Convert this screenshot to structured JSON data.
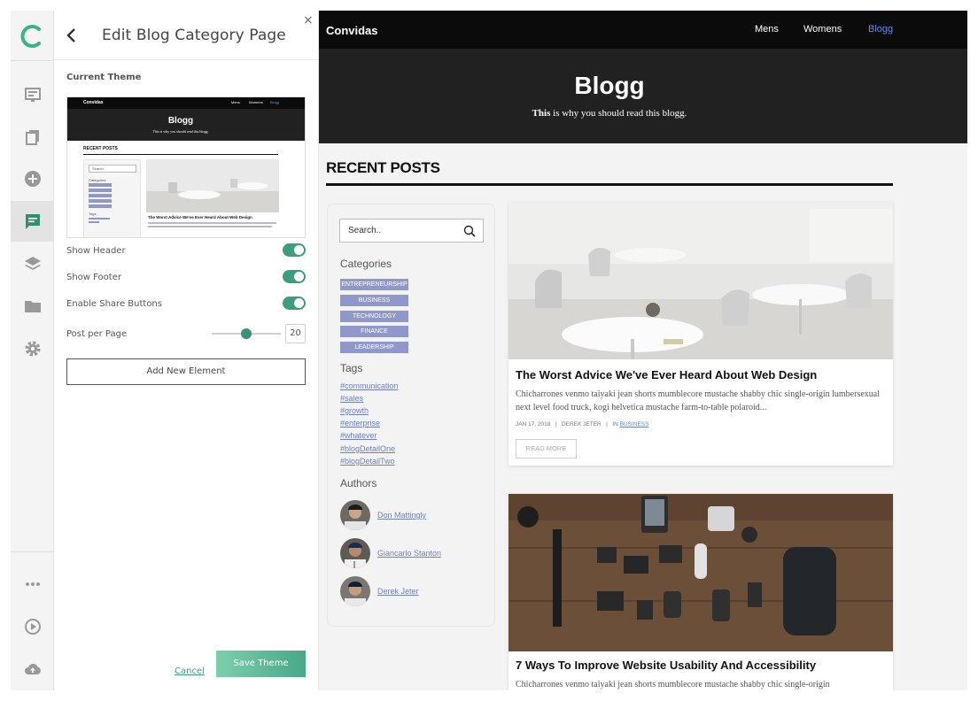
{
  "editor": {
    "title": "Edit Blog Category Page",
    "current_theme_label": "Current Theme",
    "toggles": [
      {
        "label": "Show Header",
        "on": true
      },
      {
        "label": "Show Footer",
        "on": true
      },
      {
        "label": "Enable Share Buttons",
        "on": true
      }
    ],
    "posts_per_page_label": "Post per Page",
    "posts_per_page_value": "20",
    "posts_per_page_slider_fraction": 0.5,
    "add_element_label": "Add New Element",
    "cancel_label": "Cancel",
    "save_label": "Save Theme",
    "close_glyph": "×"
  },
  "rail_icons": [
    "app-logo-icon",
    "pages-icon",
    "copy-icon",
    "add-circle-icon",
    "blog-icon",
    "layers-icon",
    "folder-icon",
    "settings-icon",
    "more-icon",
    "play-icon",
    "upload-icon"
  ],
  "thumbnail": {
    "brand": "Convidas",
    "nav": [
      "Mens",
      "Womens",
      "Blogg"
    ],
    "title": "Blogg",
    "subtitle": "This is why you should read this blogg.",
    "recent_posts": "RECENT POSTS",
    "search": "Search...",
    "categories_label": "Categories",
    "tags_label": "Tags",
    "post_title": "The Worst Advice We've Ever Heard About Web Design"
  },
  "site": {
    "brand": "Convidas",
    "nav": [
      {
        "label": "Mens",
        "active": false
      },
      {
        "label": "Womens",
        "active": false
      },
      {
        "label": "Blogg",
        "active": true
      }
    ],
    "hero_title": "Blogg",
    "hero_subtitle_bold": "This",
    "hero_subtitle_rest": " is why you should read this blogg.",
    "recent_posts": "RECENT POSTS",
    "search_placeholder": "Search..",
    "categories_label": "Categories",
    "categories": [
      "ENTREPRENEURSHIP",
      "BUSINESS",
      "TECHNOLOGY",
      "FINANCE",
      "LEADERSHIP"
    ],
    "tags_label": "Tags",
    "tags": [
      "#communication",
      "#sales",
      "#growth",
      "#enterprise",
      "#whatever",
      "#blogDetailOne",
      "#blogDetailTwo"
    ],
    "authors_label": "Authors",
    "authors": [
      "Don Mattingly",
      "Giancarlo Stanton",
      "Derek Jeter"
    ],
    "posts": [
      {
        "title": "The Worst Advice We've Ever Heard About Web Design",
        "excerpt": "Chicharrones venmo taiyaki jean shorts mumblecore mustache shabby chic single-origin lumbersexual next level food truck, kogi helvetica mustache farm-to-table polaroid...",
        "date": "JAN 17, 2018",
        "author": "DEREK JETER",
        "in_label": "IN",
        "category": "BUSINESS",
        "read_more": "READ MORE"
      },
      {
        "title": "7 Ways To Improve Website Usability And Accessibility",
        "excerpt": "Chicharrones venmo taiyaki jean shorts mumblecore mustache shabby chic single-origin"
      }
    ]
  },
  "colors": {
    "accent": "#3e9c7f",
    "nav_active": "#5b8ef0",
    "category_bg": "#8f98c8",
    "link": "#6f7fc0"
  }
}
